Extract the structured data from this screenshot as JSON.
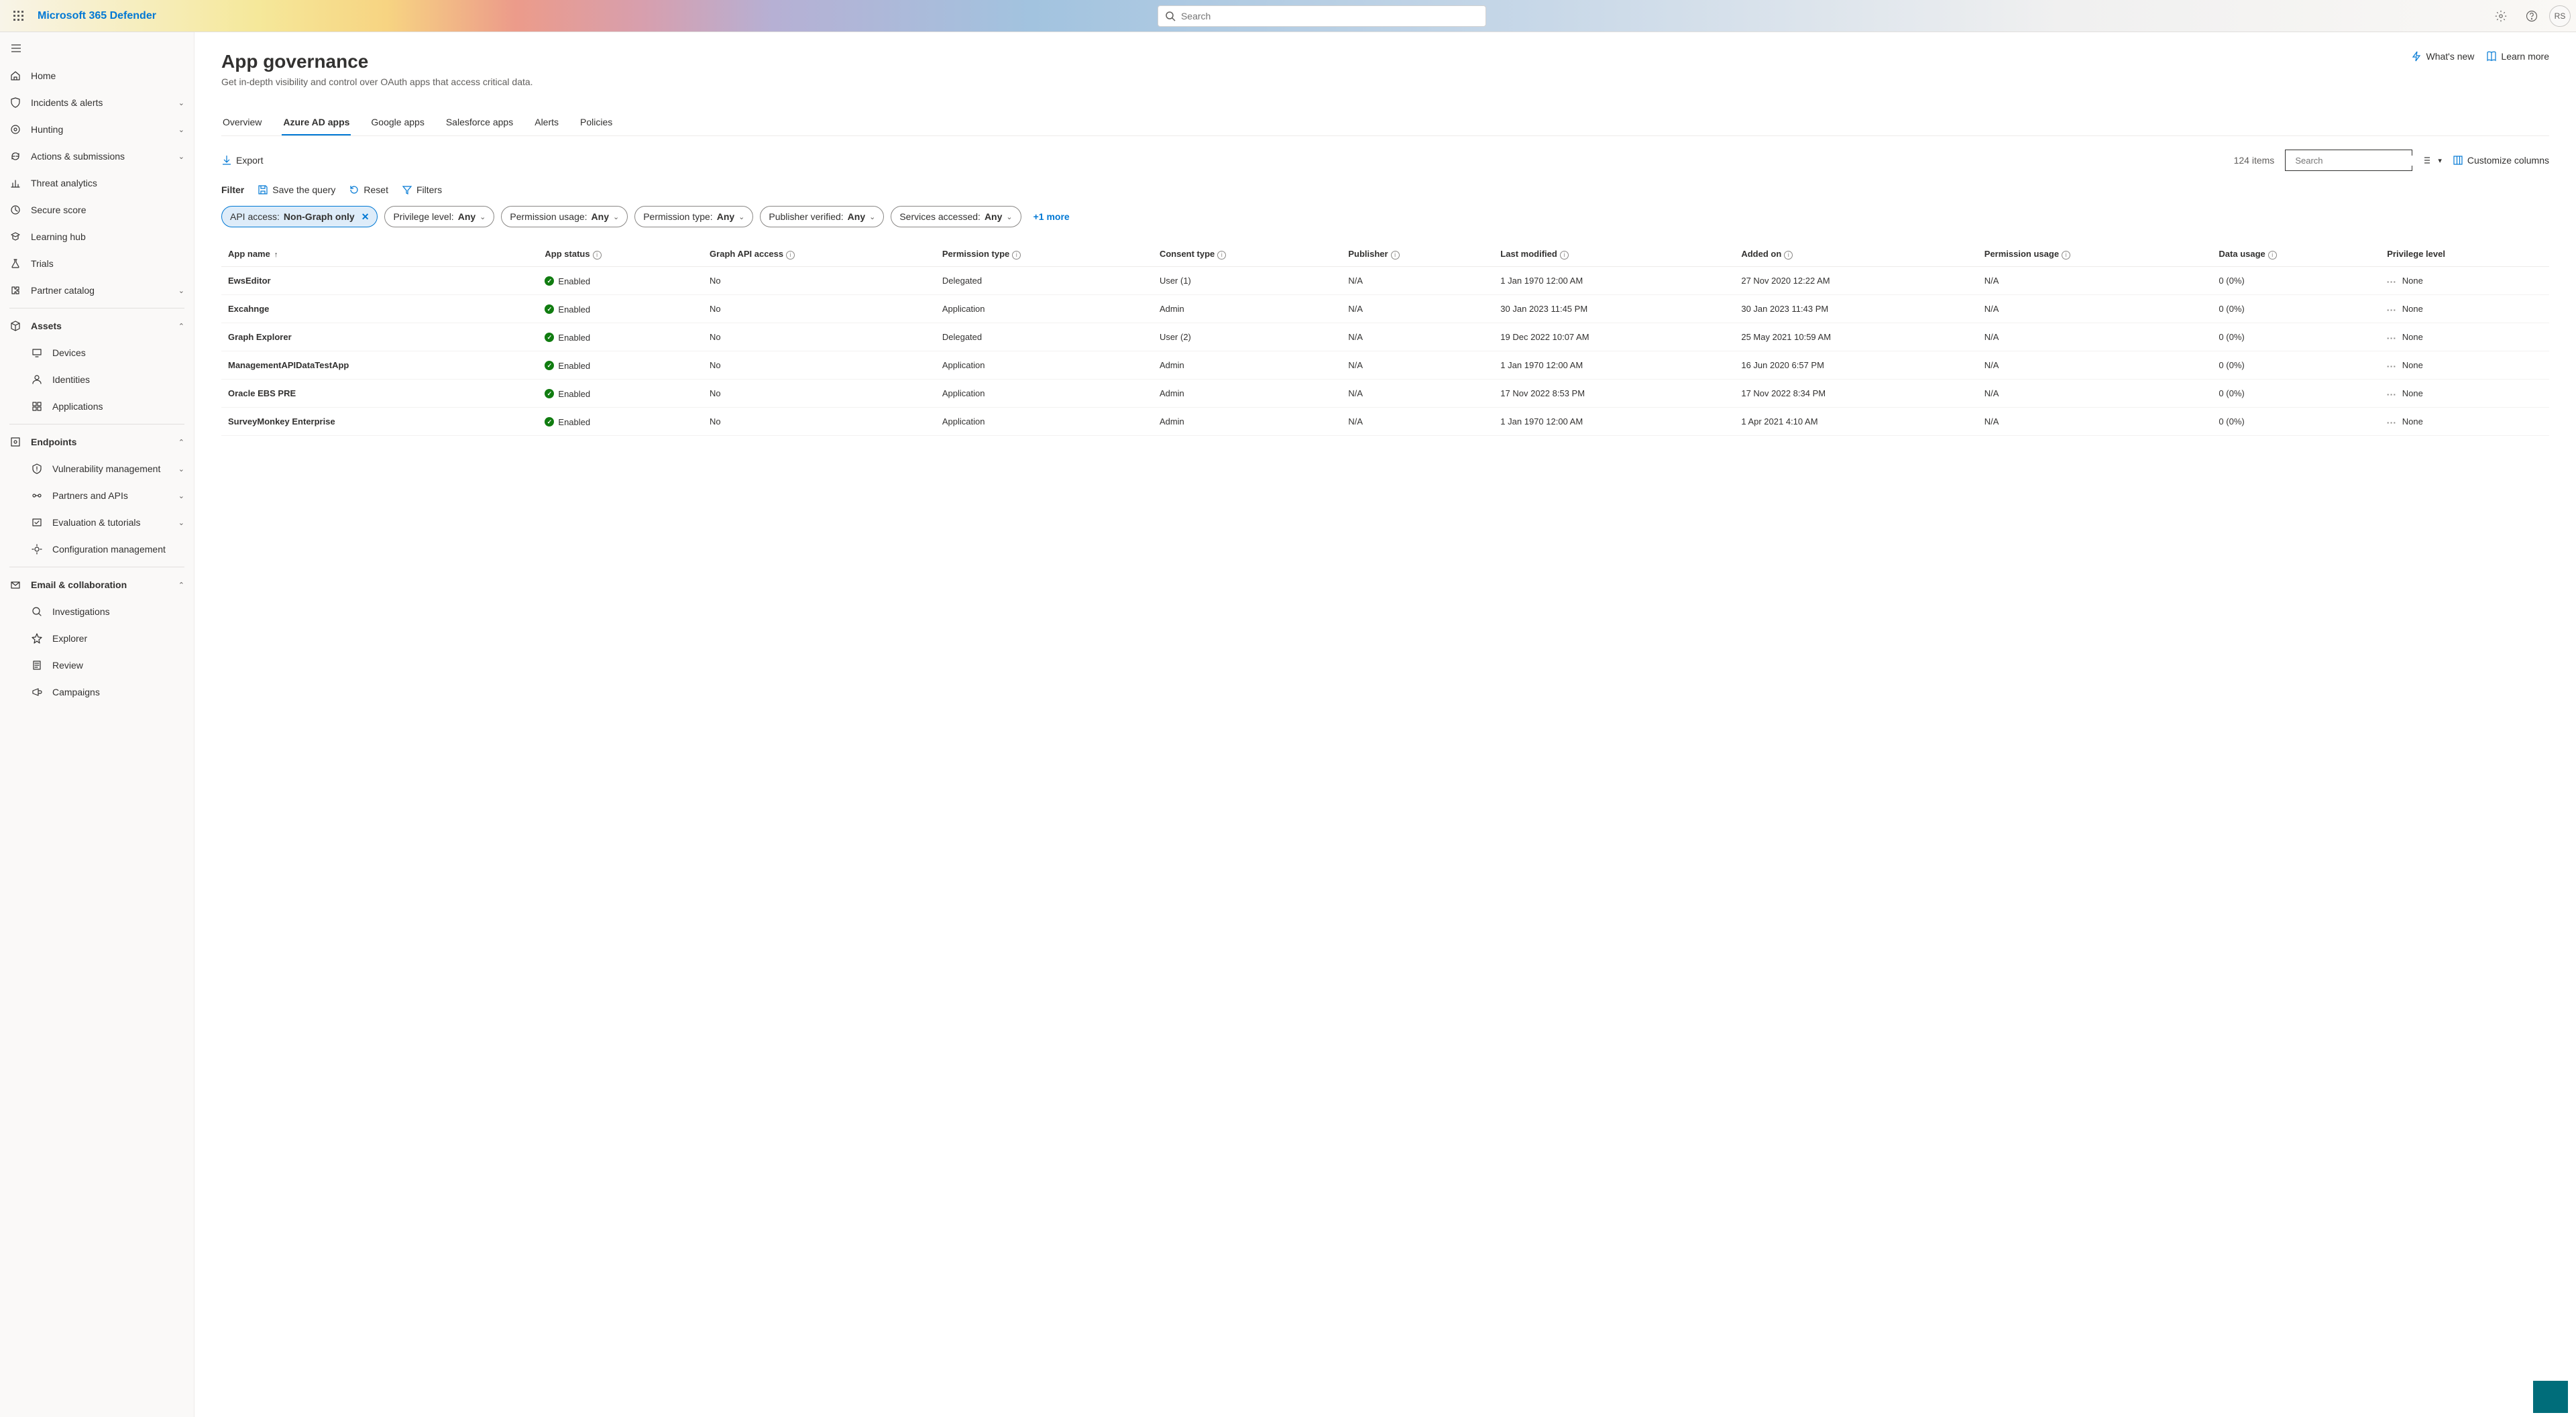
{
  "brand": "Microsoft 365 Defender",
  "global_search_placeholder": "Search",
  "avatar_initials": "RS",
  "nav": {
    "items": [
      {
        "label": "Home",
        "icon": "home",
        "kind": "item"
      },
      {
        "label": "Incidents & alerts",
        "icon": "shield",
        "kind": "expand"
      },
      {
        "label": "Hunting",
        "icon": "target",
        "kind": "expand"
      },
      {
        "label": "Actions & submissions",
        "icon": "cycle",
        "kind": "expand"
      },
      {
        "label": "Threat analytics",
        "icon": "analytics",
        "kind": "item"
      },
      {
        "label": "Secure score",
        "icon": "score",
        "kind": "item"
      },
      {
        "label": "Learning hub",
        "icon": "learn",
        "kind": "item"
      },
      {
        "label": "Trials",
        "icon": "flask",
        "kind": "item"
      },
      {
        "label": "Partner catalog",
        "icon": "puzzle",
        "kind": "expand"
      },
      {
        "kind": "sep"
      },
      {
        "label": "Assets",
        "icon": "cube",
        "kind": "header-open"
      },
      {
        "label": "Devices",
        "icon": "device",
        "kind": "child"
      },
      {
        "label": "Identities",
        "icon": "person",
        "kind": "child"
      },
      {
        "label": "Applications",
        "icon": "apps",
        "kind": "child"
      },
      {
        "kind": "sep"
      },
      {
        "label": "Endpoints",
        "icon": "endpoint",
        "kind": "header-open"
      },
      {
        "label": "Vulnerability management",
        "icon": "vuln",
        "kind": "child-expand"
      },
      {
        "label": "Partners and APIs",
        "icon": "api",
        "kind": "child-expand"
      },
      {
        "label": "Evaluation & tutorials",
        "icon": "eval",
        "kind": "child-expand"
      },
      {
        "label": "Configuration management",
        "icon": "config",
        "kind": "child"
      },
      {
        "kind": "sep"
      },
      {
        "label": "Email & collaboration",
        "icon": "mail",
        "kind": "header-open"
      },
      {
        "label": "Investigations",
        "icon": "invest",
        "kind": "child"
      },
      {
        "label": "Explorer",
        "icon": "explorer",
        "kind": "child"
      },
      {
        "label": "Review",
        "icon": "review",
        "kind": "child"
      },
      {
        "label": "Campaigns",
        "icon": "campaign",
        "kind": "child"
      }
    ]
  },
  "page": {
    "title": "App governance",
    "subtitle": "Get in-depth visibility and control over OAuth apps that access critical data.",
    "whats_new": "What's new",
    "learn_more": "Learn more"
  },
  "tabs": [
    "Overview",
    "Azure AD apps",
    "Google apps",
    "Salesforce apps",
    "Alerts",
    "Policies"
  ],
  "active_tab": 1,
  "toolbar": {
    "export": "Export",
    "item_count": "124 items",
    "table_search_placeholder": "Search",
    "customize": "Customize columns"
  },
  "filter_bar": {
    "filter_label": "Filter",
    "save_query": "Save the query",
    "reset": "Reset",
    "filters": "Filters"
  },
  "pills": [
    {
      "key": "API access:",
      "val": "Non-Graph only",
      "applied": true
    },
    {
      "key": "Privilege level:",
      "val": "Any",
      "applied": false
    },
    {
      "key": "Permission usage:",
      "val": "Any",
      "applied": false
    },
    {
      "key": "Permission type:",
      "val": "Any",
      "applied": false
    },
    {
      "key": "Publisher verified:",
      "val": "Any",
      "applied": false
    },
    {
      "key": "Services accessed:",
      "val": "Any",
      "applied": false
    }
  ],
  "pills_more": "+1 more",
  "columns": [
    {
      "label": "App name",
      "sort": "asc"
    },
    {
      "label": "App status",
      "info": true
    },
    {
      "label": "Graph API access",
      "info": true
    },
    {
      "label": "Permission type",
      "info": true
    },
    {
      "label": "Consent type",
      "info": true
    },
    {
      "label": "Publisher",
      "info": true
    },
    {
      "label": "Last modified",
      "info": true
    },
    {
      "label": "Added on",
      "info": true
    },
    {
      "label": "Permission usage",
      "info": true
    },
    {
      "label": "Data usage",
      "info": true
    },
    {
      "label": "Privilege level"
    }
  ],
  "rows": [
    {
      "name": "EwsEditor",
      "status": "Enabled",
      "graph": "No",
      "ptype": "Delegated",
      "consent": "User (1)",
      "publisher": "N/A",
      "modified": "1 Jan 1970 12:00 AM",
      "added": "27 Nov 2020 12:22 AM",
      "pusage": "N/A",
      "dusage": "0 (0%)",
      "priv": "None"
    },
    {
      "name": "Excahnge",
      "status": "Enabled",
      "graph": "No",
      "ptype": "Application",
      "consent": "Admin",
      "publisher": "N/A",
      "modified": "30 Jan 2023 11:45 PM",
      "added": "30 Jan 2023 11:43 PM",
      "pusage": "N/A",
      "dusage": "0 (0%)",
      "priv": "None"
    },
    {
      "name": "Graph Explorer",
      "status": "Enabled",
      "graph": "No",
      "ptype": "Delegated",
      "consent": "User (2)",
      "publisher": "N/A",
      "modified": "19 Dec 2022 10:07 AM",
      "added": "25 May 2021 10:59 AM",
      "pusage": "N/A",
      "dusage": "0 (0%)",
      "priv": "None"
    },
    {
      "name": "ManagementAPIDataTestApp",
      "status": "Enabled",
      "graph": "No",
      "ptype": "Application",
      "consent": "Admin",
      "publisher": "N/A",
      "modified": "1 Jan 1970 12:00 AM",
      "added": "16 Jun 2020 6:57 PM",
      "pusage": "N/A",
      "dusage": "0 (0%)",
      "priv": "None"
    },
    {
      "name": "Oracle EBS PRE",
      "status": "Enabled",
      "graph": "No",
      "ptype": "Application",
      "consent": "Admin",
      "publisher": "N/A",
      "modified": "17 Nov 2022 8:53 PM",
      "added": "17 Nov 2022 8:34 PM",
      "pusage": "N/A",
      "dusage": "0 (0%)",
      "priv": "None"
    },
    {
      "name": "SurveyMonkey Enterprise",
      "status": "Enabled",
      "graph": "No",
      "ptype": "Application",
      "consent": "Admin",
      "publisher": "N/A",
      "modified": "1 Jan 1970 12:00 AM",
      "added": "1 Apr 2021 4:10 AM",
      "pusage": "N/A",
      "dusage": "0 (0%)",
      "priv": "None"
    }
  ]
}
